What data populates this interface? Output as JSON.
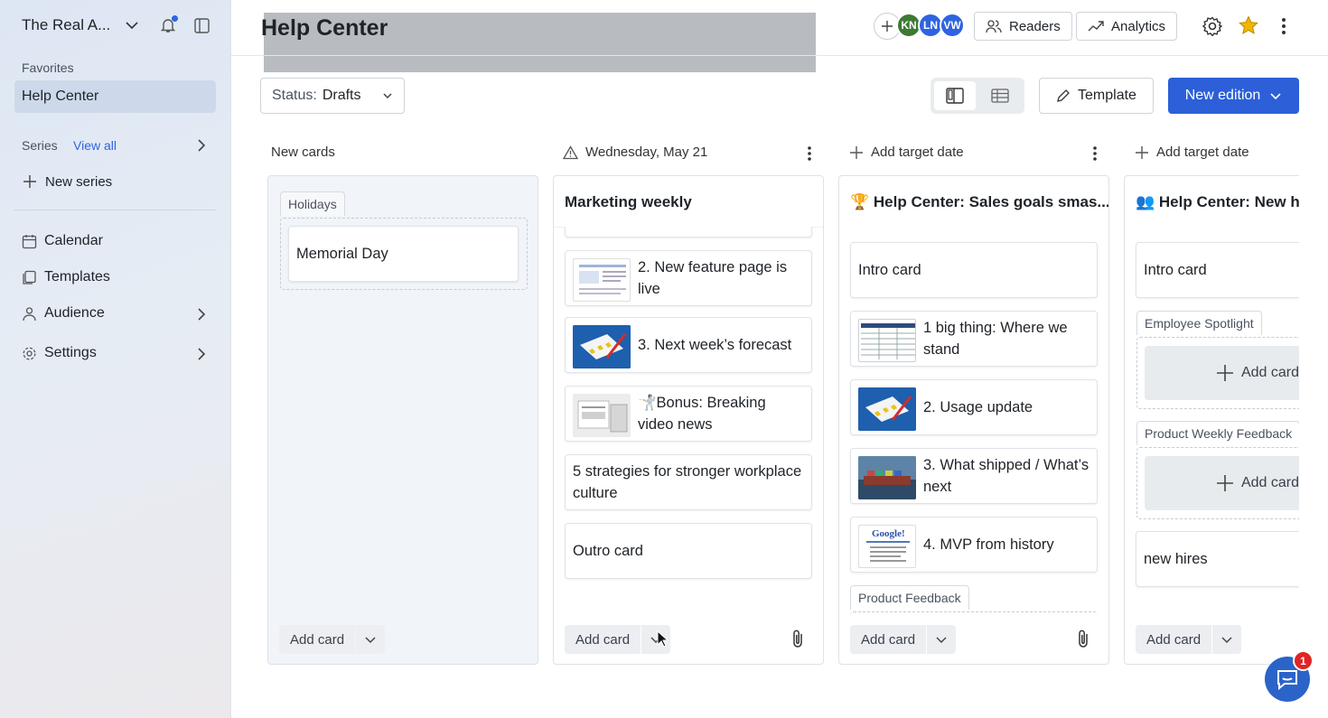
{
  "sidebar": {
    "workspace_name": "The Real A...",
    "favorites_label": "Favorites",
    "active_item": "Help Center",
    "series_label": "Series",
    "view_all": "View all",
    "new_series": "New series",
    "nav": [
      {
        "label": "Calendar",
        "icon": "calendar-icon"
      },
      {
        "label": "Templates",
        "icon": "templates-icon"
      },
      {
        "label": "Audience",
        "icon": "audience-icon"
      },
      {
        "label": "Settings",
        "icon": "gear-icon"
      }
    ]
  },
  "header": {
    "title": "Help Center",
    "avatars": [
      {
        "initials": "KN",
        "color": "#3d7a33"
      },
      {
        "initials": "LN",
        "color": "#2f63e0"
      },
      {
        "initials": "VW",
        "color": "#2f63e0"
      }
    ],
    "readers": "Readers",
    "analytics": "Analytics"
  },
  "toolbar": {
    "status_label": "Status:",
    "status_value": "Drafts",
    "template": "Template",
    "new_edition": "New edition"
  },
  "columns": {
    "new_cards": {
      "header": "New cards",
      "group_tag": "Holidays",
      "cards": [
        "Memorial Day"
      ],
      "add_card": "Add card"
    },
    "marketing": {
      "date": "Wednesday, May 21",
      "title": "Marketing weekly",
      "cards": [
        "2. New feature page is live",
        "3. Next week’s forecast",
        "🤺Bonus: Breaking video news",
        "5 strategies for stronger workplace culture",
        "Outro card"
      ],
      "add_card": "Add card"
    },
    "sales": {
      "date": "Add target date",
      "title": "🏆 Help Center: Sales goals smas...",
      "cards": [
        "Intro card",
        "1 big thing: Where we stand",
        "2. Usage update",
        "3. What shipped / What’s next",
        "4. MVP from history"
      ],
      "group_tag": "Product Feedback",
      "add_card": "Add card"
    },
    "hires": {
      "date": "Add target date",
      "title": "👥 Help Center: New hir",
      "cards": [
        "Intro card",
        "new hires"
      ],
      "group_tags": [
        "Employee Spotlight",
        "Product Weekly Feedback"
      ],
      "add_inner": "Add card",
      "add_card": "Add card"
    }
  },
  "help_badge": "1"
}
